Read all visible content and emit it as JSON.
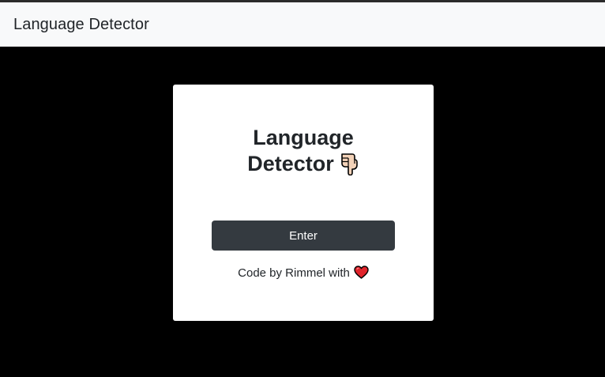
{
  "navbar": {
    "brand": "Language Detector"
  },
  "card": {
    "title_line1": "Language",
    "title_line2": "Detector",
    "title_icon": "pointing-down-hand-icon",
    "enter_label": "Enter",
    "credit_text": "Code by Rimmel with",
    "credit_icon": "heart-icon"
  },
  "colors": {
    "navbar_bg": "#f8f9fa",
    "page_bg": "#000000",
    "card_bg": "#ffffff",
    "button_bg": "#343a40",
    "heart": "#e0242b"
  }
}
